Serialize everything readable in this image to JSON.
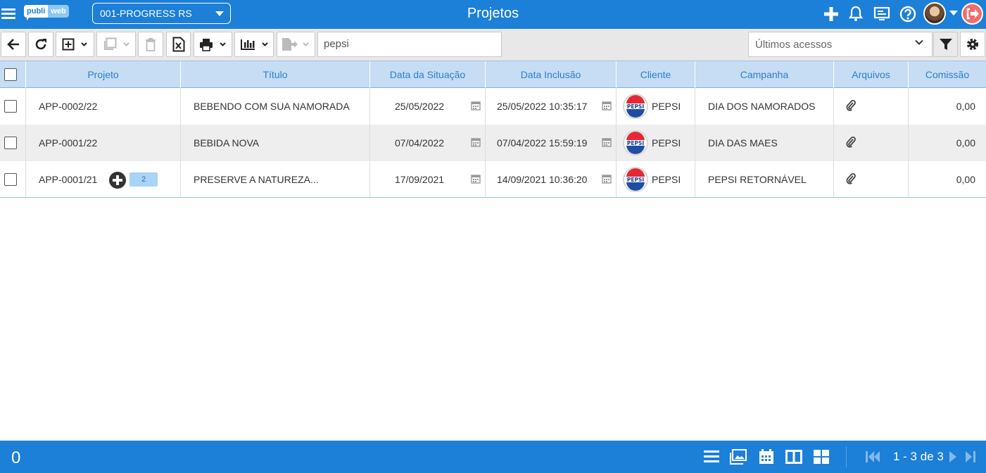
{
  "header": {
    "logo_part1": "publi",
    "logo_part2": "web",
    "company_select": "001-PROGRESS RS",
    "title": "Projetos"
  },
  "toolbar": {
    "search_value": "pepsi",
    "recent_select": "Últimos acessos"
  },
  "table": {
    "columns": [
      "Projeto",
      "Título",
      "Data da Situação",
      "Data Inclusão",
      "Cliente",
      "Campanha",
      "Arquivos",
      "Comissão"
    ],
    "rows": [
      {
        "projeto": "APP-0002/22",
        "titulo": "BEBENDO COM SUA NAMORADA",
        "data_situacao": "25/05/2022",
        "data_inclusao": "25/05/2022 10:35:17",
        "cliente": "PEPSI",
        "campanha": "DIA DOS NAMORADOS",
        "comissao": "0,00"
      },
      {
        "projeto": "APP-0001/22",
        "titulo": "BEBIDA NOVA",
        "data_situacao": "07/04/2022",
        "data_inclusao": "07/04/2022 15:59:19",
        "cliente": "PEPSI",
        "campanha": "DIA DAS MAES",
        "comissao": "0,00"
      },
      {
        "projeto": "APP-0001/21",
        "titulo": "PRESERVE A NATUREZA...",
        "data_situacao": "17/09/2021",
        "data_inclusao": "14/09/2021 10:36:20",
        "cliente": "PEPSI",
        "campanha": "PEPSI RETORNÁVEL",
        "comissao": "0,00",
        "badge": "2"
      }
    ],
    "client_logo_text": "PEPSI"
  },
  "footer": {
    "selected_count": "0",
    "paging": "1 - 3 de 3"
  },
  "colors": {
    "primary": "#1c7fd8",
    "header_row": "#c6ddf3",
    "logout": "#f06d6d"
  }
}
